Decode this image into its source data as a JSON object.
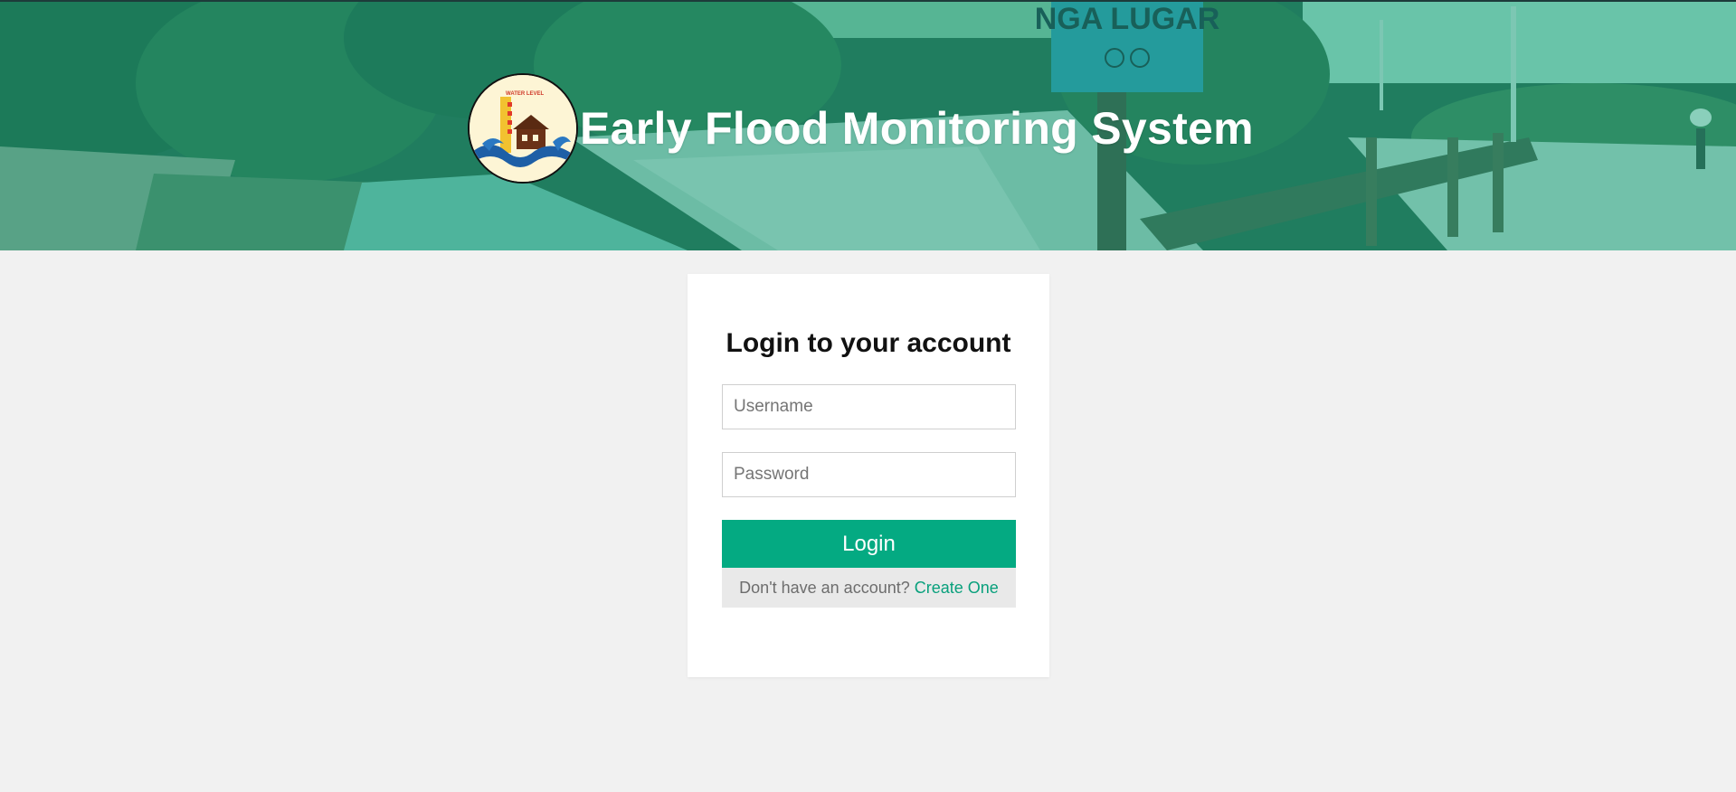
{
  "header": {
    "title": "Early Flood Monitoring System",
    "logo_text": "WATER LEVEL",
    "sign_text": "NGA LUGAR",
    "overlay_color": "#1aaf8c"
  },
  "login": {
    "heading": "Login to your account",
    "username_placeholder": "Username",
    "password_placeholder": "Password",
    "login_label": "Login",
    "no_account_text": "Don't have an account?",
    "create_link": "Create One"
  },
  "colors": {
    "accent": "#04aa82",
    "link": "#08a07c",
    "page_bg": "#f1f1f1"
  }
}
